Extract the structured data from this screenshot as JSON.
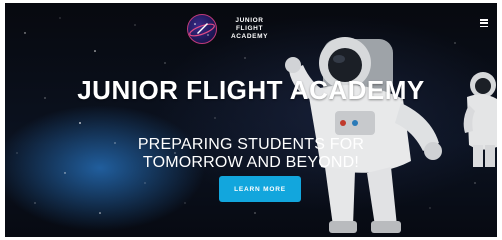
{
  "brand": {
    "name_line1": "JUNIOR FLIGHT",
    "name_line2": "ACADEMY"
  },
  "hero": {
    "title": "JUNIOR FLIGHT ACADEMY",
    "subtitle_line1": "PREPARING STUDENTS FOR",
    "subtitle_line2": "TOMORROW AND BEYOND!",
    "cta_label": "LEARN MORE"
  },
  "icons": {
    "menu": "hamburger-menu-icon",
    "logo": "rocket-planet-logo-icon"
  },
  "colors": {
    "cta": "#12a6dd",
    "background": "#0b1220",
    "text": "#ffffff"
  }
}
